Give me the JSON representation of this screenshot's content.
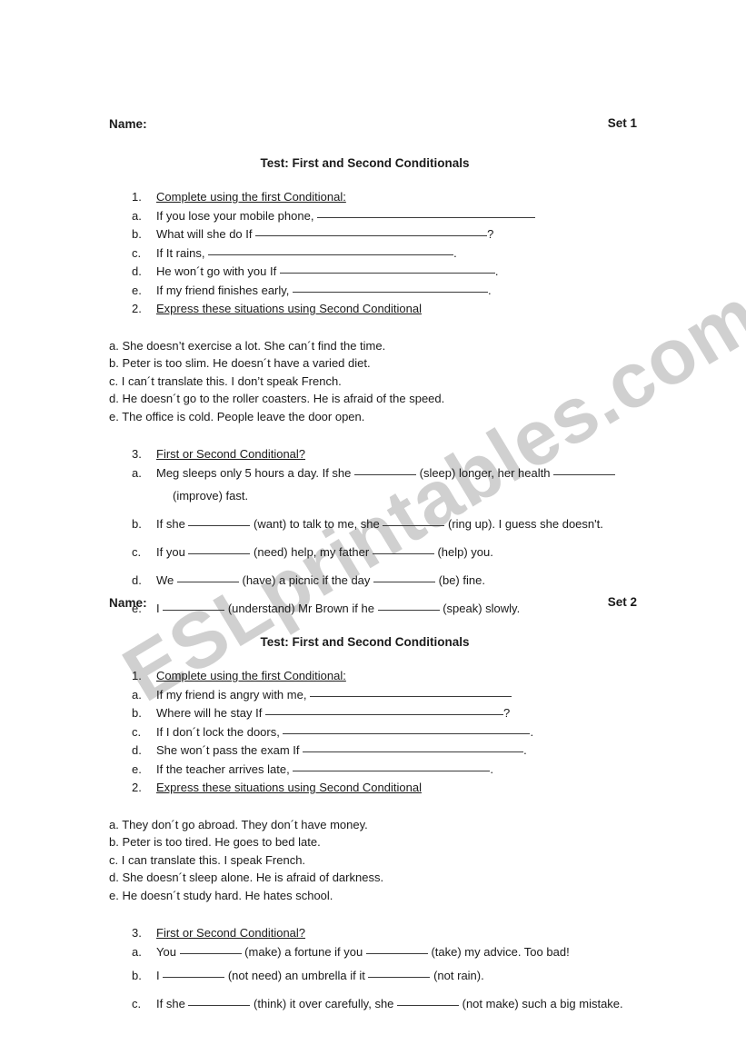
{
  "watermark": {
    "text": "ESLprintables.com",
    "color": "#d0d0d0"
  },
  "document": {
    "title": "Test: First and Second Conditionals",
    "name_label": "Name:"
  },
  "sets": [
    {
      "set_label": "Set 1",
      "name_label": "Name:",
      "title": "Test: First and Second Conditionals",
      "section1": {
        "number": "1.",
        "heading": "Complete using the first Conditional:",
        "items": [
          {
            "marker": "a.",
            "text": "If you lose your mobile phone,",
            "rule_width": 240,
            "tail": ""
          },
          {
            "marker": "b.",
            "text": "What will she do If",
            "rule_width": 255,
            "tail": "?"
          },
          {
            "marker": "c.",
            "text": "If It rains,",
            "rule_width": 270,
            "tail": "."
          },
          {
            "marker": "d.",
            "text": "He won´t go with you If",
            "rule_width": 237,
            "tail": "."
          },
          {
            "marker": "e.",
            "text": " If my friend finishes early,",
            "rule_width": 215,
            "tail": "."
          }
        ]
      },
      "section2": {
        "number": "2.",
        "heading": "Express these situations using Second Conditional",
        "sentences": [
          "a. She doesn’t exercise a lot. She can´t find the time.",
          "b. Peter is too slim. He doesn´t have a varied diet.",
          "c. I can´t translate this. I don’t speak French.",
          "d. He doesn´t go to the roller coasters. He is afraid of the speed.",
          "e. The office is cold. People leave the door open."
        ]
      },
      "section3": {
        "number": "3.",
        "heading": "First or Second Conditional?",
        "items": [
          {
            "marker": "a.",
            "parts": [
              "Meg sleeps only 5 hours a day. If she ",
              " (sleep) longer, her health ",
              ""
            ],
            "continuation": "(improve) fast."
          },
          {
            "marker": "b.",
            "parts": [
              "If she ",
              " (want) to talk to me, she ",
              " (ring up). I guess she doesn't."
            ]
          },
          {
            "marker": "c.",
            "parts": [
              "If you ",
              " (need) help, my father ",
              " (help) you."
            ]
          },
          {
            "marker": "d.",
            "parts": [
              "We ",
              " (have) a picnic if the day ",
              " (be) fine."
            ]
          },
          {
            "marker": "e.",
            "parts": [
              "I ",
              " (understand) Mr Brown if he ",
              " (speak) slowly."
            ]
          }
        ]
      }
    },
    {
      "set_label": "Set 2",
      "name_label": "Name:",
      "title": "Test: First and Second Conditionals",
      "section1": {
        "number": "1.",
        "heading": "Complete using the first Conditional:",
        "items": [
          {
            "marker": "a.",
            "text": "If my friend is angry with me,",
            "rule_width": 222,
            "tail": ""
          },
          {
            "marker": "b.",
            "text": "Where will he stay If",
            "rule_width": 262,
            "tail": "?"
          },
          {
            "marker": "c.",
            "text": "If I don´t lock the doors,",
            "rule_width": 272,
            "tail": "."
          },
          {
            "marker": "d.",
            "text": "She won´t pass the exam If",
            "rule_width": 243,
            "tail": "."
          },
          {
            "marker": "e.",
            "text": " If the teacher arrives late,",
            "rule_width": 217,
            "tail": "."
          }
        ]
      },
      "section2": {
        "number": "2.",
        "heading": "Express these situations using Second Conditional",
        "sentences": [
          "a. They don´t go abroad. They don´t have money.",
          "b. Peter is too tired. He goes to bed late.",
          "c. I can translate this. I speak French.",
          "d. She doesn´t sleep alone. He is afraid of darkness.",
          "e. He doesn´t study hard. He hates school."
        ]
      },
      "section3": {
        "number": "3.",
        "heading": "First or Second Conditional?",
        "items": [
          {
            "marker": "a.",
            "parts": [
              "You ",
              " (make) a fortune if you ",
              " (take) my advice. Too bad!"
            ]
          },
          {
            "marker": "b.",
            "parts": [
              "I ",
              " (not need) an umbrella if it ",
              " (not rain)."
            ]
          },
          {
            "marker": "c.",
            "parts": [
              "If she ",
              " (think) it over carefully, she ",
              " (not make) such a big mistake."
            ]
          }
        ]
      }
    }
  ]
}
